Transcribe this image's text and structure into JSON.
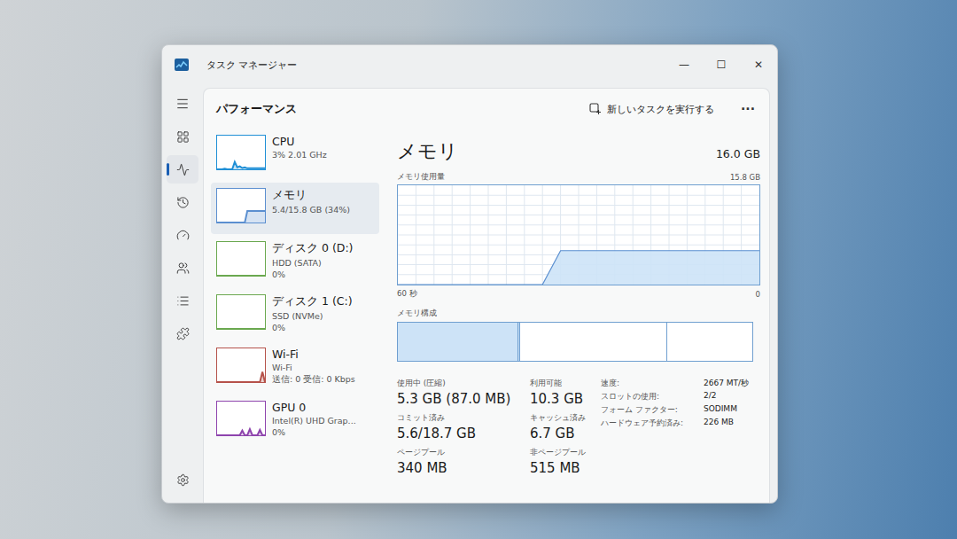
{
  "window": {
    "title": "タスク マネージャー",
    "controls": [
      "—",
      "☐",
      "✕"
    ]
  },
  "rail": [
    {
      "selected": false
    },
    {
      "selected": true
    },
    {
      "selected": false
    },
    {
      "selected": false
    },
    {
      "selected": false
    },
    {
      "selected": false
    },
    {
      "selected": false
    }
  ],
  "header": {
    "title": "パフォーマンス",
    "run_task": "新しいタスクを実行する",
    "more": "···"
  },
  "devices": [
    {
      "name": "CPU",
      "subtitle": "3% 2.01 GHz",
      "selected": false,
      "color": "#1f8fd6",
      "spark": [
        0,
        0,
        0,
        2,
        0,
        0,
        0,
        22,
        6,
        9,
        4,
        6,
        3,
        3,
        3,
        3,
        3,
        3,
        3,
        3
      ]
    },
    {
      "name": "メモリ",
      "subtitle": "5.4/15.8 GB (34%)",
      "selected": true,
      "color": "#5b8fd0",
      "spark": [
        0,
        0,
        0,
        0,
        0,
        0,
        0,
        0,
        0,
        0,
        0,
        0,
        34,
        34,
        34,
        34,
        34,
        34,
        34,
        34
      ]
    },
    {
      "name": "ディスク 0 (D:)",
      "subtitle": "HDD (SATA)",
      "value": "0%",
      "selected": false,
      "color": "#6aa84f",
      "spark": [
        0,
        0,
        0,
        0,
        0,
        0,
        0,
        0,
        0,
        0,
        0,
        0,
        0,
        0,
        0,
        0,
        0,
        0,
        0,
        0
      ]
    },
    {
      "name": "ディスク 1 (C:)",
      "subtitle": "SSD (NVMe)",
      "value": "0%",
      "selected": false,
      "color": "#6aa84f",
      "spark": [
        0,
        0,
        0,
        0,
        0,
        0,
        0,
        0,
        0,
        0,
        0,
        0,
        0,
        0,
        0,
        0,
        0,
        0,
        0,
        0
      ]
    },
    {
      "name": "Wi-Fi",
      "subtitle": "Wi-Fi",
      "value": "送信: 0 受信: 0 Kbps",
      "selected": false,
      "color": "#b5524a",
      "spark": [
        0,
        0,
        0,
        0,
        0,
        0,
        0,
        0,
        0,
        0,
        0,
        0,
        0,
        0,
        0,
        0,
        0,
        0,
        30,
        0
      ]
    },
    {
      "name": "GPU 0",
      "subtitle": "Intel(R) UHD Grap...",
      "value": "0%",
      "selected": false,
      "color": "#8e44ad",
      "spark": [
        0,
        0,
        0,
        0,
        0,
        0,
        0,
        0,
        0,
        0,
        14,
        0,
        0,
        18,
        0,
        0,
        0,
        16,
        0,
        0
      ]
    }
  ],
  "detail": {
    "title": "メモリ",
    "capacity": "16.0 GB",
    "chart": {
      "label": "メモリ使用量",
      "max_label": "15.8 GB",
      "max": 15.8,
      "time_label": "60 秒",
      "zero_label": "0",
      "values": [
        0,
        0,
        0,
        0,
        0,
        0,
        0,
        0,
        0,
        5.4,
        5.4,
        5.4,
        5.4,
        5.4,
        5.4,
        5.4,
        5.4,
        5.4,
        5.4,
        5.4,
        5.4
      ]
    },
    "composition": {
      "label": "メモリ構成",
      "segments": [
        {
          "level": 0.34,
          "color": "#cde3f7"
        },
        {
          "level": 0.005,
          "color": "#cde3f7"
        },
        {
          "level": 0.415,
          "color": "#ffffff"
        },
        {
          "level": 0.24,
          "color": "#ffffff"
        }
      ]
    },
    "stats": [
      {
        "label": "使用中 (圧縮)",
        "value": "5.3 GB (87.0 MB)"
      },
      {
        "label": "利用可能",
        "value": "10.3 GB"
      },
      {
        "label": "コミット済み",
        "value": "5.6/18.7 GB"
      },
      {
        "label": "キャッシュ済み",
        "value": "6.7 GB"
      },
      {
        "label": "ページプール",
        "value": "340 MB"
      },
      {
        "label": "非ページプール",
        "value": "515 MB"
      }
    ],
    "specs": [
      {
        "label": "速度:",
        "value": "2667 MT/秒"
      },
      {
        "label": "スロットの使用:",
        "value": "2/2"
      },
      {
        "label": "フォーム ファクター:",
        "value": "SODIMM"
      },
      {
        "label": "ハードウェア予約済み:",
        "value": "226 MB"
      }
    ]
  }
}
